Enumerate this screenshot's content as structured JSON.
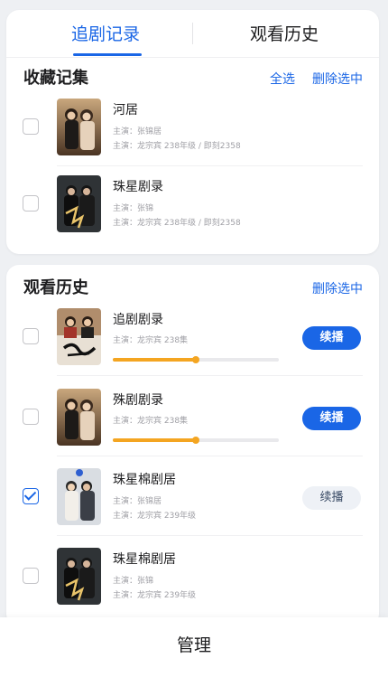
{
  "tabs": {
    "active": "追剧记录",
    "inactive": "观看历史"
  },
  "favorites": {
    "title": "收藏记集",
    "select_all": "全选",
    "delete_selected": "删除选中",
    "items": [
      {
        "title": "河居",
        "cast": "主演：张锦居",
        "meta": "主演：龙宗宾  238年级  /  即刻2358"
      },
      {
        "title": "珠星剧录",
        "cast": "主演：张锦",
        "meta": "主演：龙宗宾  238年级  /  即刻2358"
      }
    ]
  },
  "history": {
    "title": "观看历史",
    "delete_selected": "删除选中",
    "items": [
      {
        "title": "追剧剧录",
        "meta": "主演：龙宗宾  238集",
        "progress": 0.5,
        "play": "续播",
        "checked": false
      },
      {
        "title": "殊剧剧录",
        "meta": "主演：龙宗宾  238集",
        "progress": 0.5,
        "play": "续播",
        "checked": false
      },
      {
        "title": "珠星棉剧居",
        "cast": "主演：张锦居",
        "meta": "主演：龙宗宾  239年级",
        "play": "续播",
        "checked": true
      },
      {
        "title": "珠星棉剧居",
        "cast": "主演：张锦",
        "meta": "主演：龙宗宾  239年级",
        "checked": false
      }
    ]
  },
  "bottom": {
    "manage": "管理"
  },
  "colors": {
    "accent": "#1a66e6",
    "progress": "#f4a521",
    "background": "#eef0f3"
  },
  "icons": {
    "checkbox_checked": "checkmark-icon"
  }
}
